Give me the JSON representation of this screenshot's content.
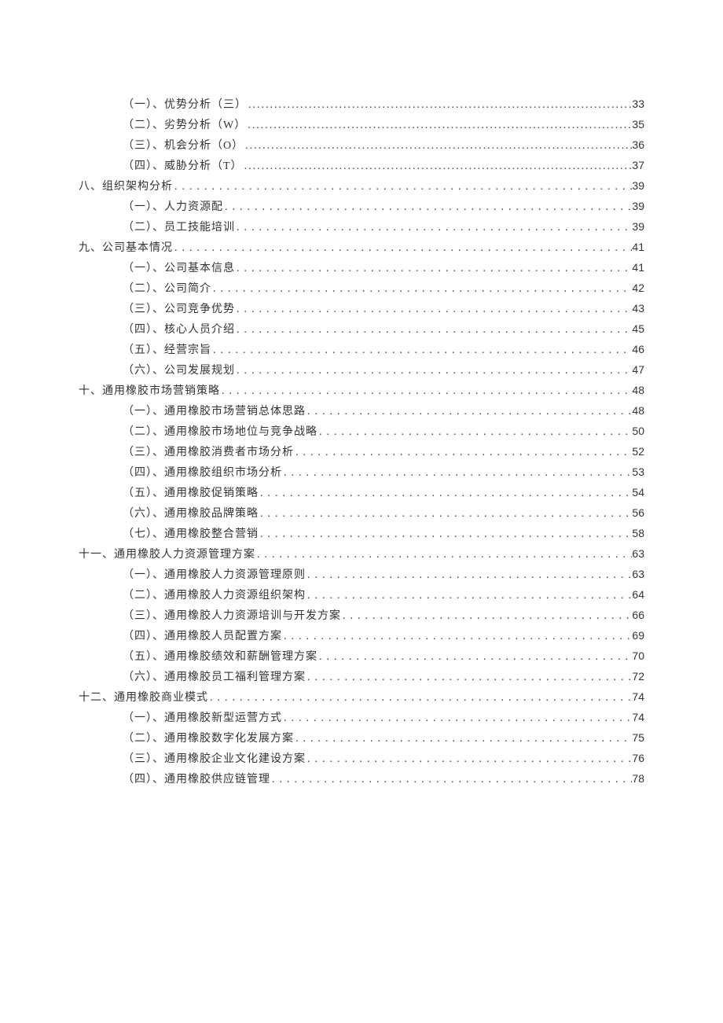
{
  "toc": [
    {
      "level": 2,
      "label": "（一）、优势分析（三）",
      "page": "33",
      "dots": "dense"
    },
    {
      "level": 2,
      "label": "（二）、劣势分析（W）",
      "page": "35",
      "dots": "dense"
    },
    {
      "level": 2,
      "label": "（三）、机会分析（O）",
      "page": "36",
      "dots": "dense"
    },
    {
      "level": 2,
      "label": "（四）、威胁分析（T）",
      "page": "37",
      "dots": "dense"
    },
    {
      "level": 1,
      "label": "八、组织架构分析",
      "page": "39",
      "dots": "sparse"
    },
    {
      "level": 2,
      "label": "（一）、人力资源配",
      "page": "39",
      "dots": "sparse"
    },
    {
      "level": 2,
      "label": "（二）、员工技能培训",
      "page": "39",
      "dots": "sparse"
    },
    {
      "level": 1,
      "label": "九、公司基本情况",
      "page": "41",
      "dots": "sparse"
    },
    {
      "level": 2,
      "label": "（一）、公司基本信息",
      "page": "41",
      "dots": "sparse"
    },
    {
      "level": 2,
      "label": "（二）、公司简介",
      "page": "42",
      "dots": "sparse"
    },
    {
      "level": 2,
      "label": "（三）、公司竞争优势",
      "page": "43",
      "dots": "sparse"
    },
    {
      "level": 2,
      "label": "（四）、核心人员介绍",
      "page": "45",
      "dots": "sparse"
    },
    {
      "level": 2,
      "label": "（五）、经营宗旨",
      "page": "46",
      "dots": "sparse"
    },
    {
      "level": 2,
      "label": "（六）、公司发展规划",
      "page": "47",
      "dots": "sparse"
    },
    {
      "level": 1,
      "label": "十、通用橡胶市场营销策略",
      "page": "48",
      "dots": "sparse"
    },
    {
      "level": 2,
      "label": "（一）、通用橡胶市场营销总体思路",
      "page": "48",
      "dots": "sparse"
    },
    {
      "level": 2,
      "label": "（二）、通用橡胶市场地位与竞争战略",
      "page": "50",
      "dots": "sparse"
    },
    {
      "level": 2,
      "label": "（三）、通用橡胶消费者市场分析",
      "page": "52",
      "dots": "sparse"
    },
    {
      "level": 2,
      "label": "（四）、通用橡胶组织市场分析",
      "page": "53",
      "dots": "sparse"
    },
    {
      "level": 2,
      "label": "（五）、通用橡胶促销策略",
      "page": "54",
      "dots": "sparse"
    },
    {
      "level": 2,
      "label": "（六）、通用橡胶品牌策略",
      "page": "56",
      "dots": "sparse"
    },
    {
      "level": 2,
      "label": "（七）、通用橡胶整合营销",
      "page": "58",
      "dots": "sparse"
    },
    {
      "level": 1,
      "label": "十一、通用橡胶人力资源管理方案",
      "page": "63",
      "dots": "sparse"
    },
    {
      "level": 2,
      "label": "（一）、通用橡胶人力资源管理原则",
      "page": "63",
      "dots": "sparse"
    },
    {
      "level": 2,
      "label": "（二）、通用橡胶人力资源组织架构",
      "page": "64",
      "dots": "sparse"
    },
    {
      "level": 2,
      "label": "（三）、通用橡胶人力资源培训与开发方案",
      "page": "66",
      "dots": "sparse"
    },
    {
      "level": 2,
      "label": "（四）、通用橡胶人员配置方案",
      "page": "69",
      "dots": "sparse"
    },
    {
      "level": 2,
      "label": "（五）、通用橡胶绩效和薪酬管理方案",
      "page": "70",
      "dots": "sparse"
    },
    {
      "level": 2,
      "label": "（六）、通用橡胶员工福利管理方案",
      "page": "72",
      "dots": "sparse"
    },
    {
      "level": 1,
      "label": "十二、通用橡胶商业模式",
      "page": "74",
      "dots": "sparse"
    },
    {
      "level": 2,
      "label": "（一）、通用橡胶新型运营方式",
      "page": "74",
      "dots": "sparse"
    },
    {
      "level": 2,
      "label": "（二）、通用橡胶数字化发展方案",
      "page": "75",
      "dots": "sparse"
    },
    {
      "level": 2,
      "label": "（三）、通用橡胶企业文化建设方案",
      "page": "76",
      "dots": "sparse"
    },
    {
      "level": 2,
      "label": "（四）、通用橡胶供应链管理",
      "page": "78",
      "dots": "sparse"
    }
  ]
}
